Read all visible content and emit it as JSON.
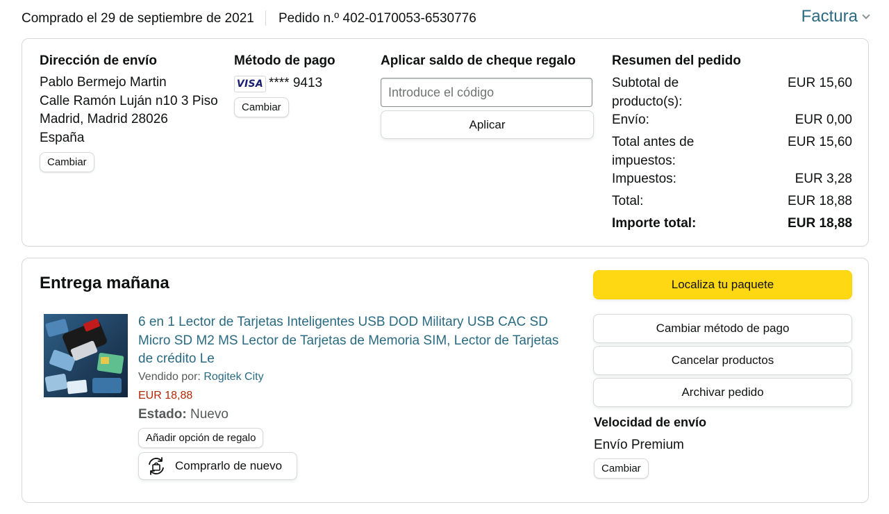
{
  "header": {
    "order_date": "Comprado el 29 de septiembre de 2021",
    "order_number": "Pedido n.º 402-0170053-6530776",
    "invoice_label": "Factura",
    "invoice_icon": "chevron-down-icon"
  },
  "shipping": {
    "title": "Dirección de envío",
    "name": "Pablo Bermejo Martin",
    "street": "Calle Ramón Luján n10 3 Piso",
    "city": "Madrid, Madrid 28026",
    "country": "España",
    "change_label": "Cambiar"
  },
  "payment": {
    "title": "Método de pago",
    "card_brand": "VISA",
    "card_number": "**** 9413",
    "change_label": "Cambiar"
  },
  "gift": {
    "title": "Aplicar saldo de cheque regalo",
    "placeholder": "Introduce el código",
    "value": "",
    "apply_label": "Aplicar"
  },
  "summary": {
    "title": "Resumen del pedido",
    "rows": [
      {
        "label": "Subtotal de producto(s):",
        "value": "EUR 15,60"
      },
      {
        "label": "Envío:",
        "value": "EUR 0,00"
      },
      {
        "label": "Total antes de impuestos:",
        "value": "EUR 15,60"
      },
      {
        "label": "Impuestos:",
        "value": "EUR 3,28"
      },
      {
        "label": "Total:",
        "value": "EUR 18,88"
      },
      {
        "label": "Importe total:",
        "value": "EUR 18,88"
      }
    ]
  },
  "delivery": {
    "title": "Entrega mañana",
    "product": {
      "title": "6 en 1 Lector de Tarjetas Inteligentes USB DOD Military USB CAC SD Micro SD M2 MS Lector de Tarjetas de Memoria SIM, Lector de Tarjetas de crédito Le",
      "seller_label": "Vendido por:",
      "seller_name": "Rogitek City",
      "price": "EUR 18,88",
      "condition_label": "Estado:",
      "condition_value": "Nuevo",
      "gift_option_label": "Añadir opción de regalo",
      "buy_again_label": "Comprarlo de nuevo"
    },
    "actions": {
      "track": "Localiza tu paquete",
      "change_payment": "Cambiar método de pago",
      "cancel": "Cancelar productos",
      "archive": "Archivar pedido"
    },
    "shipping_speed": {
      "title": "Velocidad de envío",
      "value": "Envío Premium",
      "change_label": "Cambiar"
    }
  },
  "colors": {
    "link": "#2a6a82",
    "price": "#b12704",
    "primary_button": "#ffd814",
    "border": "#d5d9d9"
  }
}
